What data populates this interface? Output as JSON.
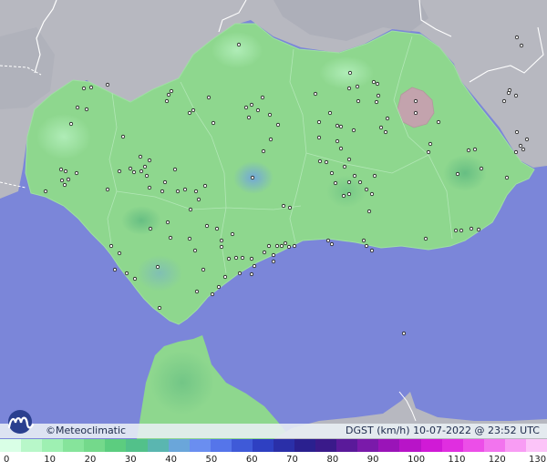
{
  "header": {
    "brand": "©Meteoclimatic",
    "variable": "DGST (km/h)",
    "timestamp": "10-07-2022 @ 23:52 UTC"
  },
  "legend": {
    "ticks": [
      "0",
      "10",
      "20",
      "30",
      "40",
      "50",
      "60",
      "70",
      "80",
      "90",
      "100",
      "110",
      "120",
      "130"
    ],
    "colors": [
      "#d9ffe6",
      "#b8f7c9",
      "#9ef0b2",
      "#86e49b",
      "#74d98b",
      "#5ccd7f",
      "#52c18a",
      "#5ab6b0",
      "#6aa6da",
      "#6a8ef0",
      "#5575ea",
      "#3f5ad8",
      "#2e40c2",
      "#2a2fa8",
      "#2a208f",
      "#3a1a8a",
      "#5a1a9a",
      "#7a1aaa",
      "#9a14b8",
      "#b814c8",
      "#d01ad6",
      "#e02ee0",
      "#ec4ee8",
      "#f274ee",
      "#f89cf4",
      "#fcc4f8"
    ],
    "min": 0,
    "max": 130
  },
  "map": {
    "sea_color": "#7b86d9",
    "land_color": "#8ed78e",
    "foreign_land_color": "#b7b8c0",
    "hill_color": "#c3a3ad"
  },
  "stations": [
    [
      92,
      97
    ],
    [
      100,
      96
    ],
    [
      118,
      93
    ],
    [
      85,
      118
    ],
    [
      78,
      136
    ],
    [
      95,
      120
    ],
    [
      67,
      186
    ],
    [
      72,
      188
    ],
    [
      68,
      198
    ],
    [
      75,
      197
    ],
    [
      84,
      190
    ],
    [
      71,
      203
    ],
    [
      50,
      210
    ],
    [
      118,
      208
    ],
    [
      122,
      270
    ],
    [
      131,
      278
    ],
    [
      126,
      296
    ],
    [
      139,
      300
    ],
    [
      148,
      306
    ],
    [
      143,
      185
    ],
    [
      147,
      189
    ],
    [
      155,
      188
    ],
    [
      159,
      183
    ],
    [
      164,
      176
    ],
    [
      154,
      172
    ],
    [
      135,
      150
    ],
    [
      131,
      188
    ],
    [
      161,
      193
    ],
    [
      164,
      206
    ],
    [
      178,
      210
    ],
    [
      181,
      200
    ],
    [
      192,
      186
    ],
    [
      195,
      210
    ],
    [
      203,
      208
    ],
    [
      215,
      210
    ],
    [
      225,
      204
    ],
    [
      218,
      219
    ],
    [
      184,
      244
    ],
    [
      173,
      293
    ],
    [
      175,
      338
    ],
    [
      209,
      230
    ],
    [
      227,
      248
    ],
    [
      243,
      264
    ],
    [
      214,
      275
    ],
    [
      223,
      296
    ],
    [
      216,
      320
    ],
    [
      240,
      315
    ],
    [
      259,
      283
    ],
    [
      263,
      300
    ],
    [
      276,
      284
    ],
    [
      279,
      292
    ],
    [
      290,
      277
    ],
    [
      295,
      270
    ],
    [
      300,
      280
    ],
    [
      304,
      270
    ],
    [
      309,
      270
    ],
    [
      313,
      267
    ],
    [
      317,
      271
    ],
    [
      323,
      270
    ],
    [
      300,
      287
    ],
    [
      276,
      301
    ],
    [
      266,
      283
    ],
    [
      255,
      257
    ],
    [
      289,
      166
    ],
    [
      297,
      153
    ],
    [
      296,
      126
    ],
    [
      305,
      137
    ],
    [
      288,
      107
    ],
    [
      262,
      49
    ],
    [
      270,
      118
    ],
    [
      276,
      115
    ],
    [
      283,
      121
    ],
    [
      273,
      129
    ],
    [
      311,
      226
    ],
    [
      238,
      251
    ],
    [
      243,
      271
    ],
    [
      251,
      284
    ],
    [
      247,
      304
    ],
    [
      233,
      323
    ],
    [
      208,
      124
    ],
    [
      185,
      104
    ],
    [
      188,
      100
    ],
    [
      183,
      111
    ],
    [
      165,
      251
    ],
    [
      187,
      261
    ],
    [
      208,
      262
    ],
    [
      229,
      107
    ],
    [
      212,
      121
    ],
    [
      234,
      135
    ],
    [
      277,
      195
    ],
    [
      362,
      124
    ],
    [
      370,
      138
    ],
    [
      374,
      139
    ],
    [
      370,
      155
    ],
    [
      374,
      163
    ],
    [
      358,
      178
    ],
    [
      350,
      151
    ],
    [
      388,
      143
    ],
    [
      383,
      175
    ],
    [
      378,
      183
    ],
    [
      364,
      190
    ],
    [
      368,
      201
    ],
    [
      383,
      200
    ],
    [
      389,
      193
    ],
    [
      395,
      200
    ],
    [
      402,
      208
    ],
    [
      408,
      213
    ],
    [
      411,
      193
    ],
    [
      383,
      213
    ],
    [
      377,
      215
    ],
    [
      405,
      232
    ],
    [
      399,
      264
    ],
    [
      402,
      270
    ],
    [
      408,
      275
    ],
    [
      360,
      264
    ],
    [
      364,
      268
    ],
    [
      351,
      177
    ],
    [
      350,
      134
    ],
    [
      318,
      228
    ],
    [
      346,
      103
    ],
    [
      383,
      97
    ],
    [
      392,
      95
    ],
    [
      414,
      92
    ],
    [
      410,
      90
    ],
    [
      415,
      105
    ],
    [
      413,
      112
    ],
    [
      393,
      111
    ],
    [
      384,
      80
    ],
    [
      425,
      130
    ],
    [
      418,
      140
    ],
    [
      423,
      145
    ],
    [
      481,
      134
    ],
    [
      472,
      158
    ],
    [
      470,
      167
    ],
    [
      456,
      111
    ],
    [
      456,
      124
    ],
    [
      514,
      165
    ],
    [
      521,
      164
    ],
    [
      528,
      185
    ],
    [
      502,
      191
    ],
    [
      500,
      253
    ],
    [
      506,
      253
    ],
    [
      517,
      251
    ],
    [
      525,
      252
    ],
    [
      467,
      262
    ],
    [
      556,
      195
    ],
    [
      567,
      145
    ],
    [
      571,
      160
    ],
    [
      574,
      164
    ],
    [
      566,
      167
    ],
    [
      578,
      153
    ],
    [
      553,
      111
    ],
    [
      559,
      99
    ],
    [
      566,
      105
    ],
    [
      558,
      102
    ],
    [
      567,
      41
    ],
    [
      572,
      50
    ],
    [
      443,
      366
    ]
  ]
}
